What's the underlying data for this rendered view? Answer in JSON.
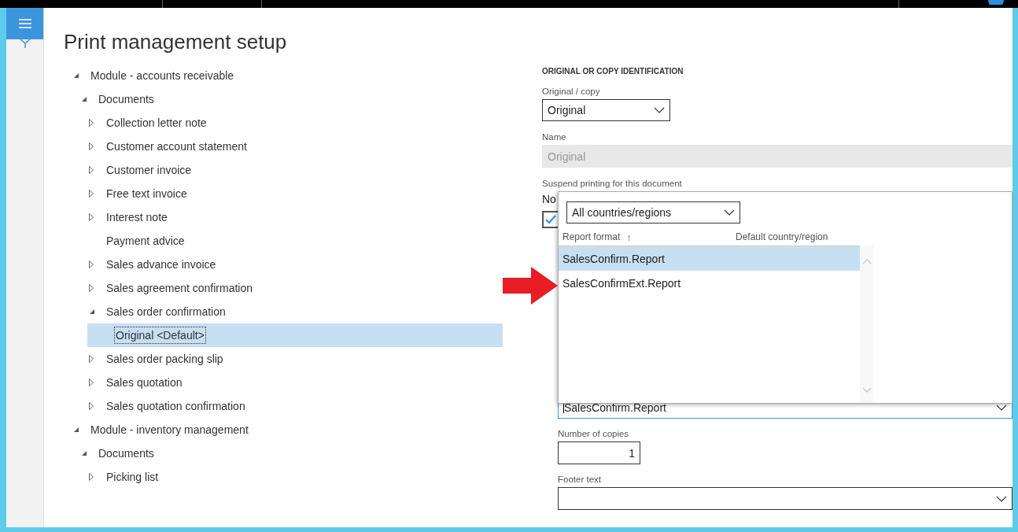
{
  "page": {
    "title": "Print management setup"
  },
  "tree": [
    {
      "label": "Module - accounts receivable",
      "has_children": true,
      "expanded": true,
      "selected": false,
      "children": [
        {
          "label": "Documents",
          "has_children": true,
          "expanded": true,
          "selected": false,
          "children": [
            {
              "label": "Collection letter note",
              "has_children": true,
              "expanded": false,
              "selected": false
            },
            {
              "label": "Customer account statement",
              "has_children": true,
              "expanded": false,
              "selected": false
            },
            {
              "label": "Customer invoice",
              "has_children": true,
              "expanded": false,
              "selected": false
            },
            {
              "label": "Free text invoice",
              "has_children": true,
              "expanded": false,
              "selected": false
            },
            {
              "label": "Interest note",
              "has_children": true,
              "expanded": false,
              "selected": false
            },
            {
              "label": "Payment advice",
              "has_children": false,
              "selected": false
            },
            {
              "label": "Sales advance invoice",
              "has_children": true,
              "expanded": false,
              "selected": false
            },
            {
              "label": "Sales agreement confirmation",
              "has_children": true,
              "expanded": false,
              "selected": false
            },
            {
              "label": "Sales order confirmation",
              "has_children": true,
              "expanded": true,
              "selected": false,
              "children": [
                {
                  "label": "Original <Default>",
                  "has_children": false,
                  "selected": true
                }
              ]
            },
            {
              "label": "Sales order packing slip",
              "has_children": true,
              "expanded": false,
              "selected": false
            },
            {
              "label": "Sales quotation",
              "has_children": true,
              "expanded": false,
              "selected": false
            },
            {
              "label": "Sales quotation confirmation",
              "has_children": true,
              "expanded": false,
              "selected": false
            }
          ]
        }
      ]
    },
    {
      "label": "Module - inventory management",
      "has_children": true,
      "expanded": true,
      "selected": false,
      "children": [
        {
          "label": "Documents",
          "has_children": true,
          "expanded": true,
          "selected": false,
          "children": [
            {
              "label": "Picking list",
              "has_children": true,
              "expanded": false,
              "selected": false
            }
          ]
        }
      ]
    }
  ],
  "details": {
    "section_title": "ORIGINAL OR COPY IDENTIFICATION",
    "original_copy": {
      "label": "Original / copy",
      "value": "Original"
    },
    "name": {
      "label": "Name",
      "value": "Original",
      "disabled": true
    },
    "suspend": {
      "label": "Suspend printing for this document",
      "value": "No"
    },
    "checkbox": {
      "checked": true
    },
    "report_format": {
      "value": "SalesConfirm.Report"
    },
    "copies": {
      "label": "Number of copies",
      "value": "1"
    },
    "footer": {
      "label": "Footer text"
    }
  },
  "report_popup": {
    "filter": "All countries/regions",
    "columns": [
      {
        "label": "Report format",
        "sort": "↑"
      },
      {
        "label": "Default country/region"
      }
    ],
    "rows": [
      {
        "report": "SalesConfirm.Report",
        "selected": true
      },
      {
        "report": "SalesConfirmExt.Report",
        "selected": false
      }
    ]
  }
}
